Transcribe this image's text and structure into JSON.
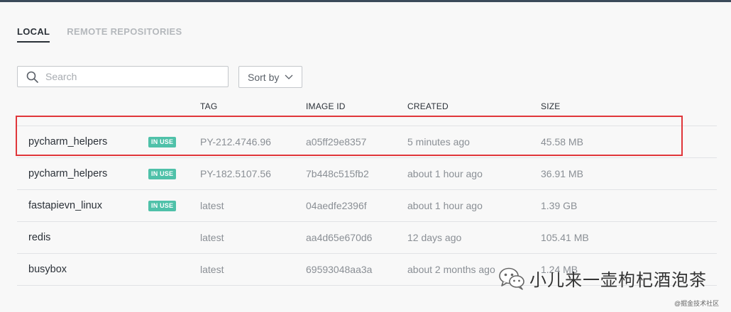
{
  "tabs": [
    {
      "label": "LOCAL",
      "active": true
    },
    {
      "label": "REMOTE REPOSITORIES",
      "active": false
    }
  ],
  "search": {
    "placeholder": "Search",
    "value": ""
  },
  "sort": {
    "label": "Sort by"
  },
  "columns": {
    "tag": "TAG",
    "image_id": "IMAGE ID",
    "created": "CREATED",
    "size": "SIZE"
  },
  "images": [
    {
      "name": "pycharm_helpers",
      "badge": "IN USE",
      "tag": "PY-212.4746.96",
      "image_id": "a05ff29e8357",
      "created": "5 minutes ago",
      "size": "45.58 MB"
    },
    {
      "name": "pycharm_helpers",
      "badge": "IN USE",
      "tag": "PY-182.5107.56",
      "image_id": "7b448c515fb2",
      "created": "about 1 hour ago",
      "size": "36.91 MB"
    },
    {
      "name": "fastapievn_linux",
      "badge": "IN USE",
      "tag": "latest",
      "image_id": "04aedfe2396f",
      "created": "about 1 hour ago",
      "size": "1.39 GB"
    },
    {
      "name": "redis",
      "badge": "",
      "tag": "latest",
      "image_id": "aa4d65e670d6",
      "created": "12 days ago",
      "size": "105.41 MB"
    },
    {
      "name": "busybox",
      "badge": "",
      "tag": "latest",
      "image_id": "69593048aa3a",
      "created": "about 2 months ago",
      "size": "1.24 MB"
    }
  ],
  "watermark": {
    "text": "小儿来一壶枸杞酒泡茶",
    "small": "@掘金技术社区"
  },
  "colors": {
    "badge": "#4fc1a9",
    "highlight": "#e0363a",
    "topbar": "#3b4a5a"
  }
}
